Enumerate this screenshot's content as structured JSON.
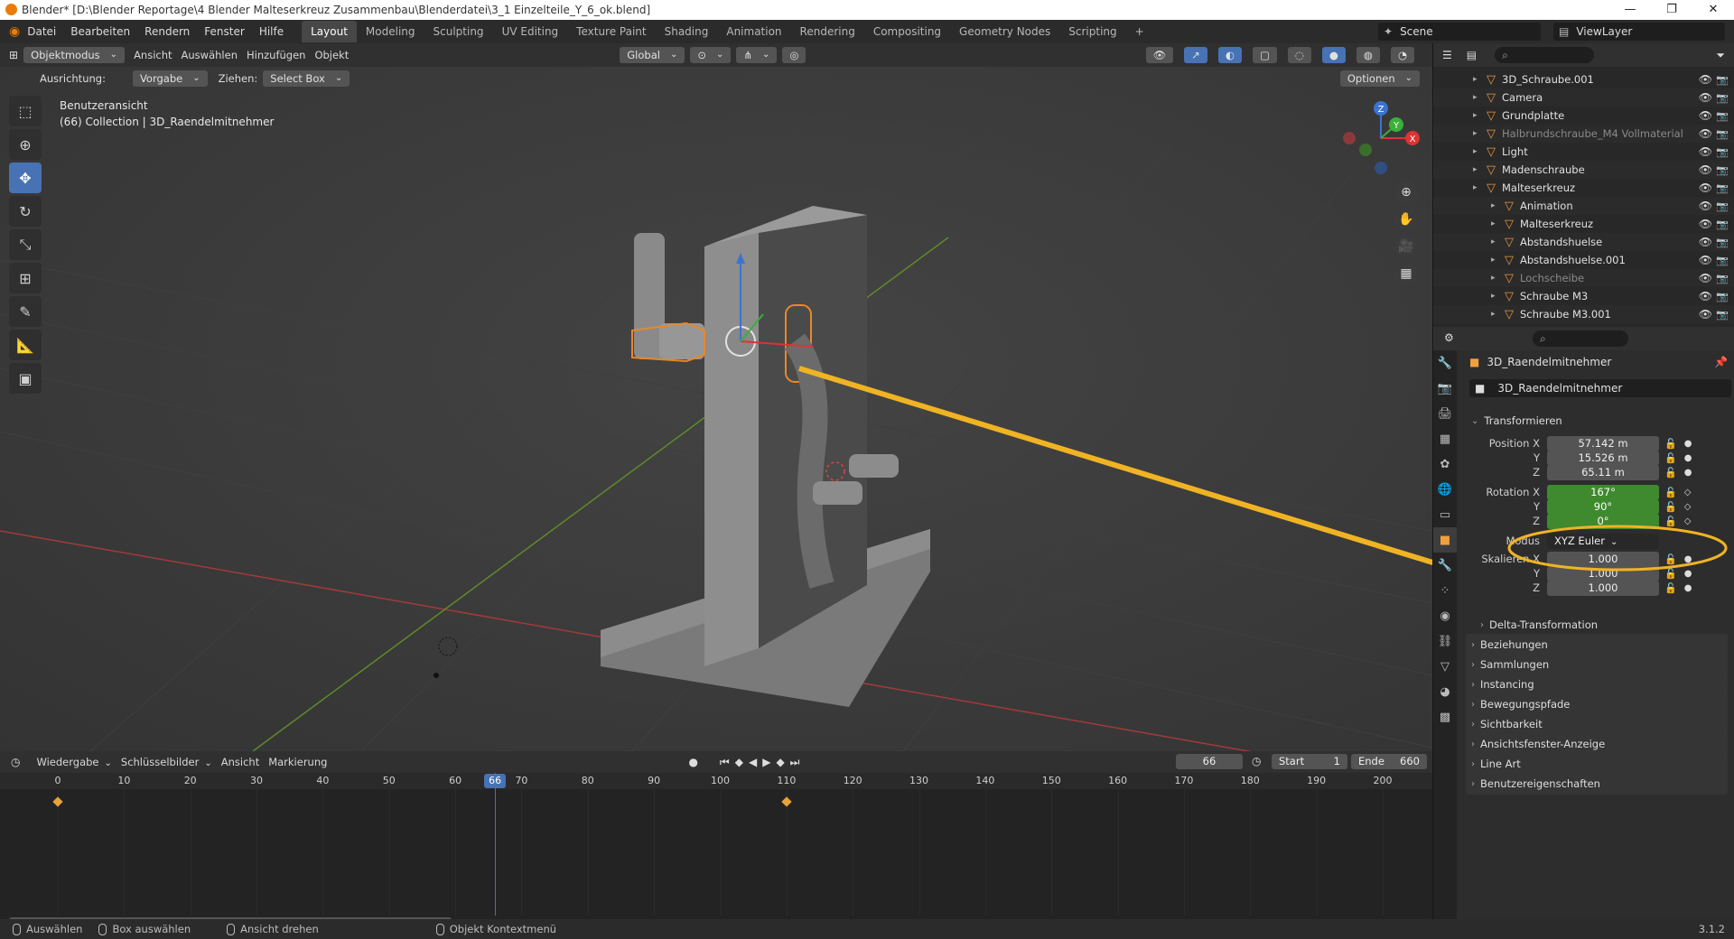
{
  "window": {
    "title": "Blender* [D:\\Blender Reportage\\4 Blender Malteserkreuz Zusammenbau\\Blenderdatei\\3_1 Einzelteile_Y_6_ok.blend]",
    "controls": [
      "—",
      "❐",
      "✕"
    ]
  },
  "menus": [
    "Datei",
    "Bearbeiten",
    "Rendern",
    "Fenster",
    "Hilfe"
  ],
  "workspaces": [
    "Layout",
    "Modeling",
    "Sculpting",
    "UV Editing",
    "Texture Paint",
    "Shading",
    "Animation",
    "Rendering",
    "Compositing",
    "Geometry Nodes",
    "Scripting",
    "+"
  ],
  "active_workspace": "Layout",
  "scene": {
    "scene_label": "Scene",
    "viewlayer_label": "ViewLayer"
  },
  "viewport_header": {
    "mode": "Objektmodus",
    "menus": [
      "Ansicht",
      "Auswählen",
      "Hinzufügen",
      "Objekt"
    ],
    "orientation": "Global",
    "options": "Optionen"
  },
  "tool_settings": {
    "ausrichtung_label": "Ausrichtung:",
    "ausrichtung_value": "Vorgabe",
    "ziehen_label": "Ziehen:",
    "ziehen_value": "Select Box"
  },
  "viewport_info": {
    "view_name": "Benutzeransicht",
    "collection": "(66) Collection | 3D_Raendelmitnehmer"
  },
  "gizmo_axes": [
    "X",
    "Y",
    "Z"
  ],
  "outliner": {
    "items": [
      {
        "label": "3D_Schraube.001",
        "indent": 0,
        "dim": false
      },
      {
        "label": "Camera",
        "indent": 0,
        "dim": false
      },
      {
        "label": "Grundplatte",
        "indent": 0,
        "dim": false
      },
      {
        "label": "Halbrundschraube_M4 Vollmaterial",
        "indent": 0,
        "dim": true
      },
      {
        "label": "Light",
        "indent": 0,
        "dim": false
      },
      {
        "label": "Madenschraube",
        "indent": 0,
        "dim": false
      },
      {
        "label": "Malteserkreuz",
        "indent": 0,
        "dim": false
      },
      {
        "label": "Animation",
        "indent": 1,
        "dim": false
      },
      {
        "label": "Malteserkreuz",
        "indent": 1,
        "dim": false
      },
      {
        "label": "Abstandshuelse",
        "indent": 1,
        "dim": false
      },
      {
        "label": "Abstandshuelse.001",
        "indent": 1,
        "dim": false
      },
      {
        "label": "Lochscheibe",
        "indent": 1,
        "dim": true
      },
      {
        "label": "Schraube M3",
        "indent": 1,
        "dim": false
      },
      {
        "label": "Schraube M3.001",
        "indent": 1,
        "dim": false
      }
    ]
  },
  "properties": {
    "object_name": "3D_Raendelmitnehmer",
    "data_name": "3D_Raendelmitnehmer",
    "section_transform": "Transformieren",
    "position": {
      "label_x": "Position X",
      "x": "57.142 m",
      "y": "15.526 m",
      "z": "65.11 m"
    },
    "rotation": {
      "label_x": "Rotation X",
      "x": "167°",
      "y": "90°",
      "z": "0°"
    },
    "mode_label": "Modus",
    "mode_value": "XYZ Euler",
    "scale": {
      "label_x": "Skalieren X",
      "x": "1.000",
      "y": "1.000",
      "z": "1.000"
    },
    "axis_y": "Y",
    "axis_z": "Z",
    "collapsed_sections": [
      "Delta-Transformation",
      "Beziehungen",
      "Sammlungen",
      "Instancing",
      "Bewegungspfade",
      "Sichtbarkeit",
      "Ansichtsfenster-Anzeige",
      "Line Art",
      "Benutzereigenschaften"
    ]
  },
  "timeline": {
    "menus": [
      "Wiedergabe",
      "Schlüsselbilder",
      "Ansicht",
      "Markierung"
    ],
    "current_frame": "66",
    "start_label": "Start",
    "start": "1",
    "end_label": "Ende",
    "end": "660",
    "ticks": [
      0,
      10,
      20,
      30,
      40,
      50,
      60,
      70,
      80,
      90,
      100,
      110,
      120,
      130,
      140,
      150,
      160,
      170,
      180,
      190,
      200
    ],
    "keyframes": [
      0,
      110
    ]
  },
  "statusbar": {
    "items": [
      "Auswählen",
      "Box auswählen",
      "Ansicht drehen",
      "Objekt Kontextmenü"
    ],
    "version": "3.1.2"
  },
  "annotation_color": "#f0b323"
}
